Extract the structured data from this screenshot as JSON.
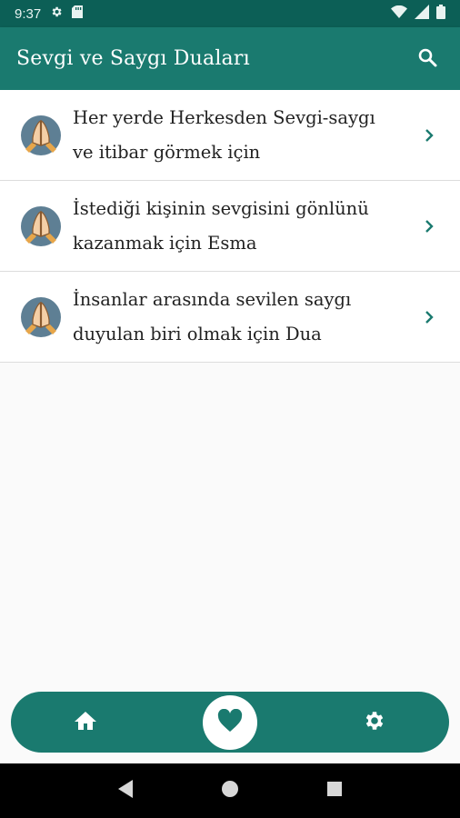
{
  "status_bar": {
    "time": "9:37",
    "icons": [
      "settings-icon",
      "sd-card-icon",
      "wifi-icon",
      "signal-icon",
      "battery-icon"
    ]
  },
  "app_bar": {
    "title": "Sevgi ve Saygı Duaları",
    "search_icon": "search-icon"
  },
  "items": [
    {
      "line1": "Her yerde Herkesden Sevgi-saygı",
      "line2": "ve itibar görmek için",
      "icon": "praying-hands-icon"
    },
    {
      "line1": "İstediği kişinin sevgisini gönlünü",
      "line2": "kazanmak için Esma",
      "icon": "praying-hands-icon"
    },
    {
      "line1": "İnsanlar arasında sevilen saygı",
      "line2": "duyulan biri olmak için Dua",
      "icon": "praying-hands-icon"
    }
  ],
  "bottom_nav": {
    "icons": [
      "home-icon",
      "heart-icon",
      "gear-icon"
    ]
  },
  "system_nav": {
    "icons": [
      "back-icon",
      "home-circle-icon",
      "recents-icon"
    ]
  },
  "colors": {
    "primary": "#1a7a6f",
    "status": "#0c5f56"
  }
}
